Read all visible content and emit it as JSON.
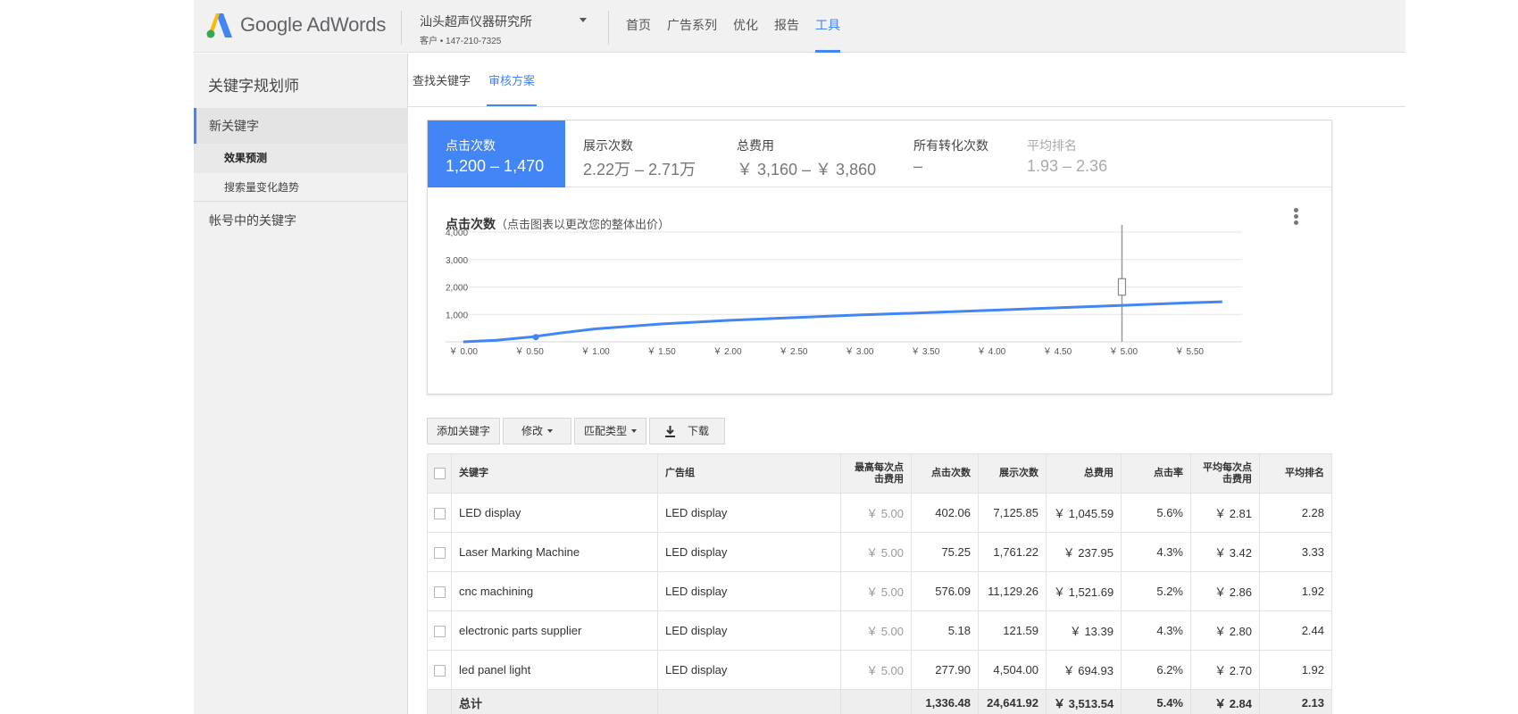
{
  "header": {
    "logo_text": "Google AdWords",
    "account_name": "汕头超声仪器研究所",
    "account_sub": "客户 • 147-210-7325",
    "nav": [
      {
        "label": "首页",
        "active": false
      },
      {
        "label": "广告系列",
        "active": false
      },
      {
        "label": "优化",
        "active": false
      },
      {
        "label": "报告",
        "active": false
      },
      {
        "label": "工具",
        "active": true
      }
    ]
  },
  "page": {
    "title": "关键字规划师",
    "tabs": [
      {
        "label": "查找关键字",
        "active": false
      },
      {
        "label": "审核方案",
        "active": true
      }
    ]
  },
  "sidebar": {
    "new_keywords": "新关键字",
    "forecast": "效果预测",
    "trends": "搜索量变化趋势",
    "account_keywords": "帐号中的关键字"
  },
  "metrics": [
    {
      "label": "点击次数",
      "value": "1,200 – 1,470",
      "state": "active"
    },
    {
      "label": "展示次数",
      "value": "2.22万 – 2.71万",
      "state": "normal"
    },
    {
      "label": "总费用",
      "value": "￥ 3,160 – ￥ 3,860",
      "state": "normal"
    },
    {
      "label": "所有转化次数",
      "value": "–",
      "state": "normal"
    },
    {
      "label": "平均排名",
      "value": "1.93 – 2.36",
      "state": "disabled"
    }
  ],
  "chart_title": {
    "main": "点击次数",
    "sub": "（点击图表以更改您的整体出价）"
  },
  "chart_data": {
    "type": "line",
    "title": "点击次数",
    "ylim": [
      0,
      4000
    ],
    "yticks": [
      1000,
      2000,
      3000,
      4000
    ],
    "ytick_labels": [
      "1,000",
      "2,000",
      "3,000",
      "4,000"
    ],
    "xticks": [
      0,
      0.5,
      1.0,
      1.5,
      2.0,
      2.5,
      3.0,
      3.5,
      4.0,
      4.5,
      5.0,
      5.5
    ],
    "xtick_labels": [
      "￥ 0.00",
      "￥ 0.50",
      "￥ 1.00",
      "￥ 1.50",
      "￥ 2.00",
      "￥ 2.50",
      "￥ 3.00",
      "￥ 3.50",
      "￥ 4.00",
      "￥ 4.50",
      "￥ 5.00",
      "￥ 5.50"
    ],
    "xlim": [
      -0.1,
      5.9
    ],
    "series": [
      {
        "x": [
          0.0,
          0.25,
          0.5,
          0.75,
          1.0,
          1.5,
          2.0,
          2.5,
          3.0,
          3.5,
          4.0,
          4.5,
          5.0,
          5.5,
          5.75
        ],
        "y": [
          0,
          60,
          170,
          330,
          470,
          650,
          780,
          880,
          980,
          1060,
          1150,
          1240,
          1330,
          1420,
          1460
        ]
      }
    ],
    "current_point": {
      "x": 0.55,
      "y": 170
    },
    "bid_marker": {
      "x": 4.99,
      "box_low": 1700,
      "box_high": 2300
    }
  },
  "toolbar": {
    "add_keyword": "添加关键字",
    "edit": "修改",
    "match_type": "匹配类型",
    "download": "下载"
  },
  "table": {
    "headers": [
      "关键字",
      "广告组",
      "最高每次点击费用",
      "点击次数",
      "展示次数",
      "总费用",
      "点击率",
      "平均每次点击费用",
      "平均排名"
    ],
    "header_lines": {
      "max_cpc": [
        "最高每次点",
        "击费用"
      ],
      "avg_cpc": [
        "平均每次点",
        "击费用"
      ]
    },
    "rows": [
      {
        "keyword": "LED display",
        "ad_group": "LED display",
        "max_cpc": "￥ 5.00",
        "clicks": "402.06",
        "impressions": "7,125.85",
        "cost": "￥ 1,045.59",
        "ctr": "5.6%",
        "avg_cpc": "￥ 2.81",
        "avg_pos": "2.28"
      },
      {
        "keyword": "Laser Marking Machine",
        "ad_group": "LED display",
        "max_cpc": "￥ 5.00",
        "clicks": "75.25",
        "impressions": "1,761.22",
        "cost": "￥ 237.95",
        "ctr": "4.3%",
        "avg_cpc": "￥ 3.42",
        "avg_pos": "3.33"
      },
      {
        "keyword": "cnc machining",
        "ad_group": "LED display",
        "max_cpc": "￥ 5.00",
        "clicks": "576.09",
        "impressions": "11,129.26",
        "cost": "￥ 1,521.69",
        "ctr": "5.2%",
        "avg_cpc": "￥ 2.86",
        "avg_pos": "1.92"
      },
      {
        "keyword": "electronic parts supplier",
        "ad_group": "LED display",
        "max_cpc": "￥ 5.00",
        "clicks": "5.18",
        "impressions": "121.59",
        "cost": "￥ 13.39",
        "ctr": "4.3%",
        "avg_cpc": "￥ 2.80",
        "avg_pos": "2.44"
      },
      {
        "keyword": "led panel light",
        "ad_group": "LED display",
        "max_cpc": "￥ 5.00",
        "clicks": "277.90",
        "impressions": "4,504.00",
        "cost": "￥ 694.93",
        "ctr": "6.2%",
        "avg_cpc": "￥ 2.70",
        "avg_pos": "1.92"
      }
    ],
    "total": {
      "label": "总计",
      "clicks": "1,336.48",
      "impressions": "24,641.92",
      "cost": "￥ 3,513.54",
      "ctr": "5.4%",
      "avg_cpc": "￥ 2.84",
      "avg_pos": "2.13"
    }
  },
  "colors": {
    "accent": "#4285f4",
    "line": "#4285f4",
    "logo_green": "#34a853",
    "logo_blue": "#4285f4",
    "logo_yellow": "#fbbc05"
  }
}
